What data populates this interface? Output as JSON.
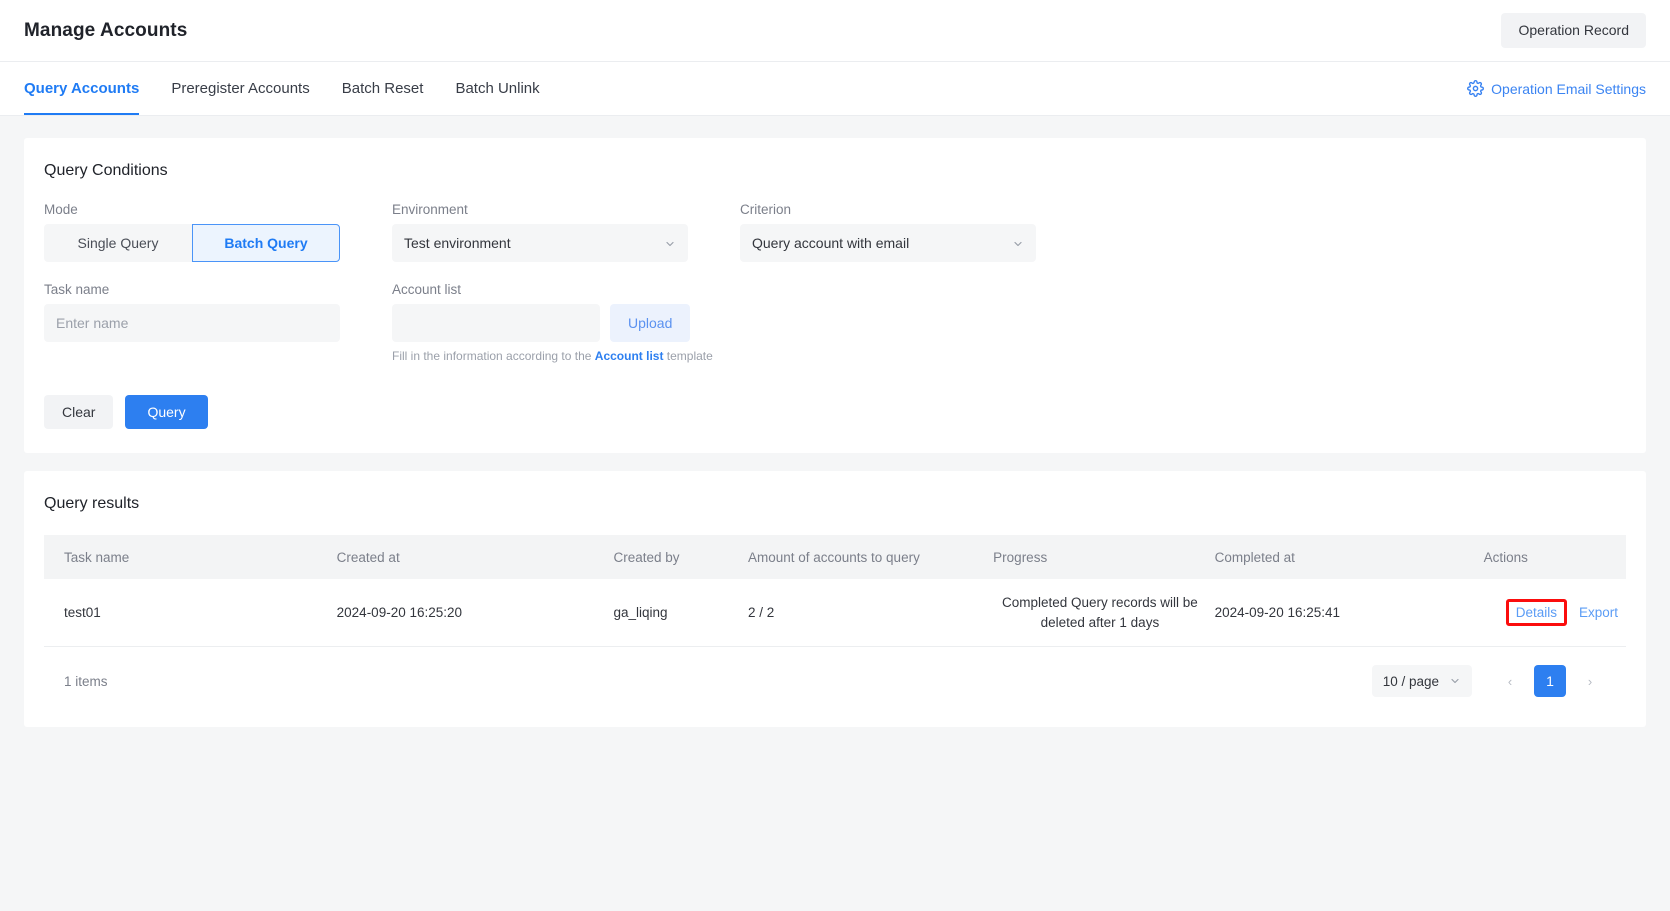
{
  "header": {
    "title": "Manage Accounts",
    "operation_record_label": "Operation Record"
  },
  "tabs": [
    {
      "label": "Query Accounts",
      "active": true
    },
    {
      "label": "Preregister Accounts",
      "active": false
    },
    {
      "label": "Batch Reset",
      "active": false
    },
    {
      "label": "Batch Unlink",
      "active": false
    }
  ],
  "email_settings": {
    "label": "Operation Email Settings",
    "icon": "gear-icon",
    "color": "#3b84f2"
  },
  "query_conditions": {
    "title": "Query Conditions",
    "mode": {
      "label": "Mode",
      "options": [
        "Single Query",
        "Batch Query"
      ],
      "selected": "Batch Query"
    },
    "environment": {
      "label": "Environment",
      "value": "Test environment"
    },
    "criterion": {
      "label": "Criterion",
      "value": "Query account with email"
    },
    "task_name": {
      "label": "Task name",
      "value": "",
      "placeholder": "Enter name"
    },
    "account_list": {
      "label": "Account list",
      "value": "",
      "placeholder": "",
      "upload_label": "Upload",
      "hint_prefix": "Fill in the information according to the ",
      "hint_link": "Account list",
      "hint_suffix": " template"
    },
    "clear_label": "Clear",
    "query_label": "Query"
  },
  "query_results": {
    "title": "Query results",
    "columns": [
      "Task name",
      "Created at",
      "Created by",
      "Amount of accounts to query",
      "Progress",
      "Completed at",
      "Actions"
    ],
    "rows": [
      {
        "task_name": "test01",
        "created_at": "2024-09-20 16:25:20",
        "created_by": "ga_liqing",
        "amount": "2 / 2",
        "progress": "Completed Query records will be deleted after 1 days",
        "completed_at": "2024-09-20 16:25:41",
        "details_label": "Details",
        "export_label": "Export"
      }
    ],
    "pagination": {
      "total_label": "1 items",
      "page_size_label": "10 / page",
      "prev_label": "‹",
      "next_label": "›",
      "current_page": "1"
    }
  },
  "accent_colors": {
    "primary": "#2d7ff0",
    "link": "#5b9cf5",
    "highlight_box": "#fb0d0d"
  }
}
